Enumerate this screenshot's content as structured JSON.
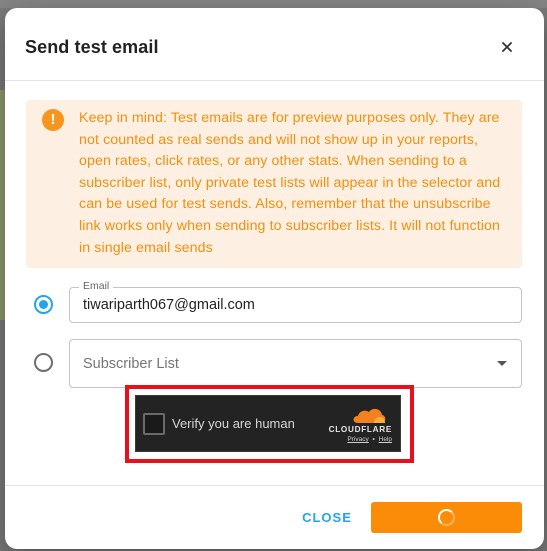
{
  "dialog": {
    "title": "Send test email"
  },
  "notice": {
    "icon": "exclamation-icon",
    "text": "Keep in mind: Test emails are for preview purposes only. They are not counted as real sends and will not show up in your reports, open rates, click rates, or any other stats. When sending to a subscriber list, only private test lists will appear in the selector and can be used for test sends. Also, remember that the unsubscribe link works only when sending to subscriber lists. It will not function in single email sends"
  },
  "email_option": {
    "label": "Email",
    "value": "tiwariparth067@gmail.com",
    "selected": true
  },
  "list_option": {
    "placeholder": "Subscriber List",
    "selected": false
  },
  "captcha": {
    "label": "Verify you are human",
    "brand": "CLOUDFLARE",
    "privacy_link": "Privacy",
    "separator": "•",
    "help_link": "Help"
  },
  "footer": {
    "close_label": "CLOSE",
    "send_state": "loading"
  },
  "colors": {
    "accent": "#23a5e8",
    "primary_button": "#fb8c07",
    "notice_bg": "#fdf0e2",
    "notice_text": "#f0900f",
    "highlight_border": "#e8101a"
  }
}
